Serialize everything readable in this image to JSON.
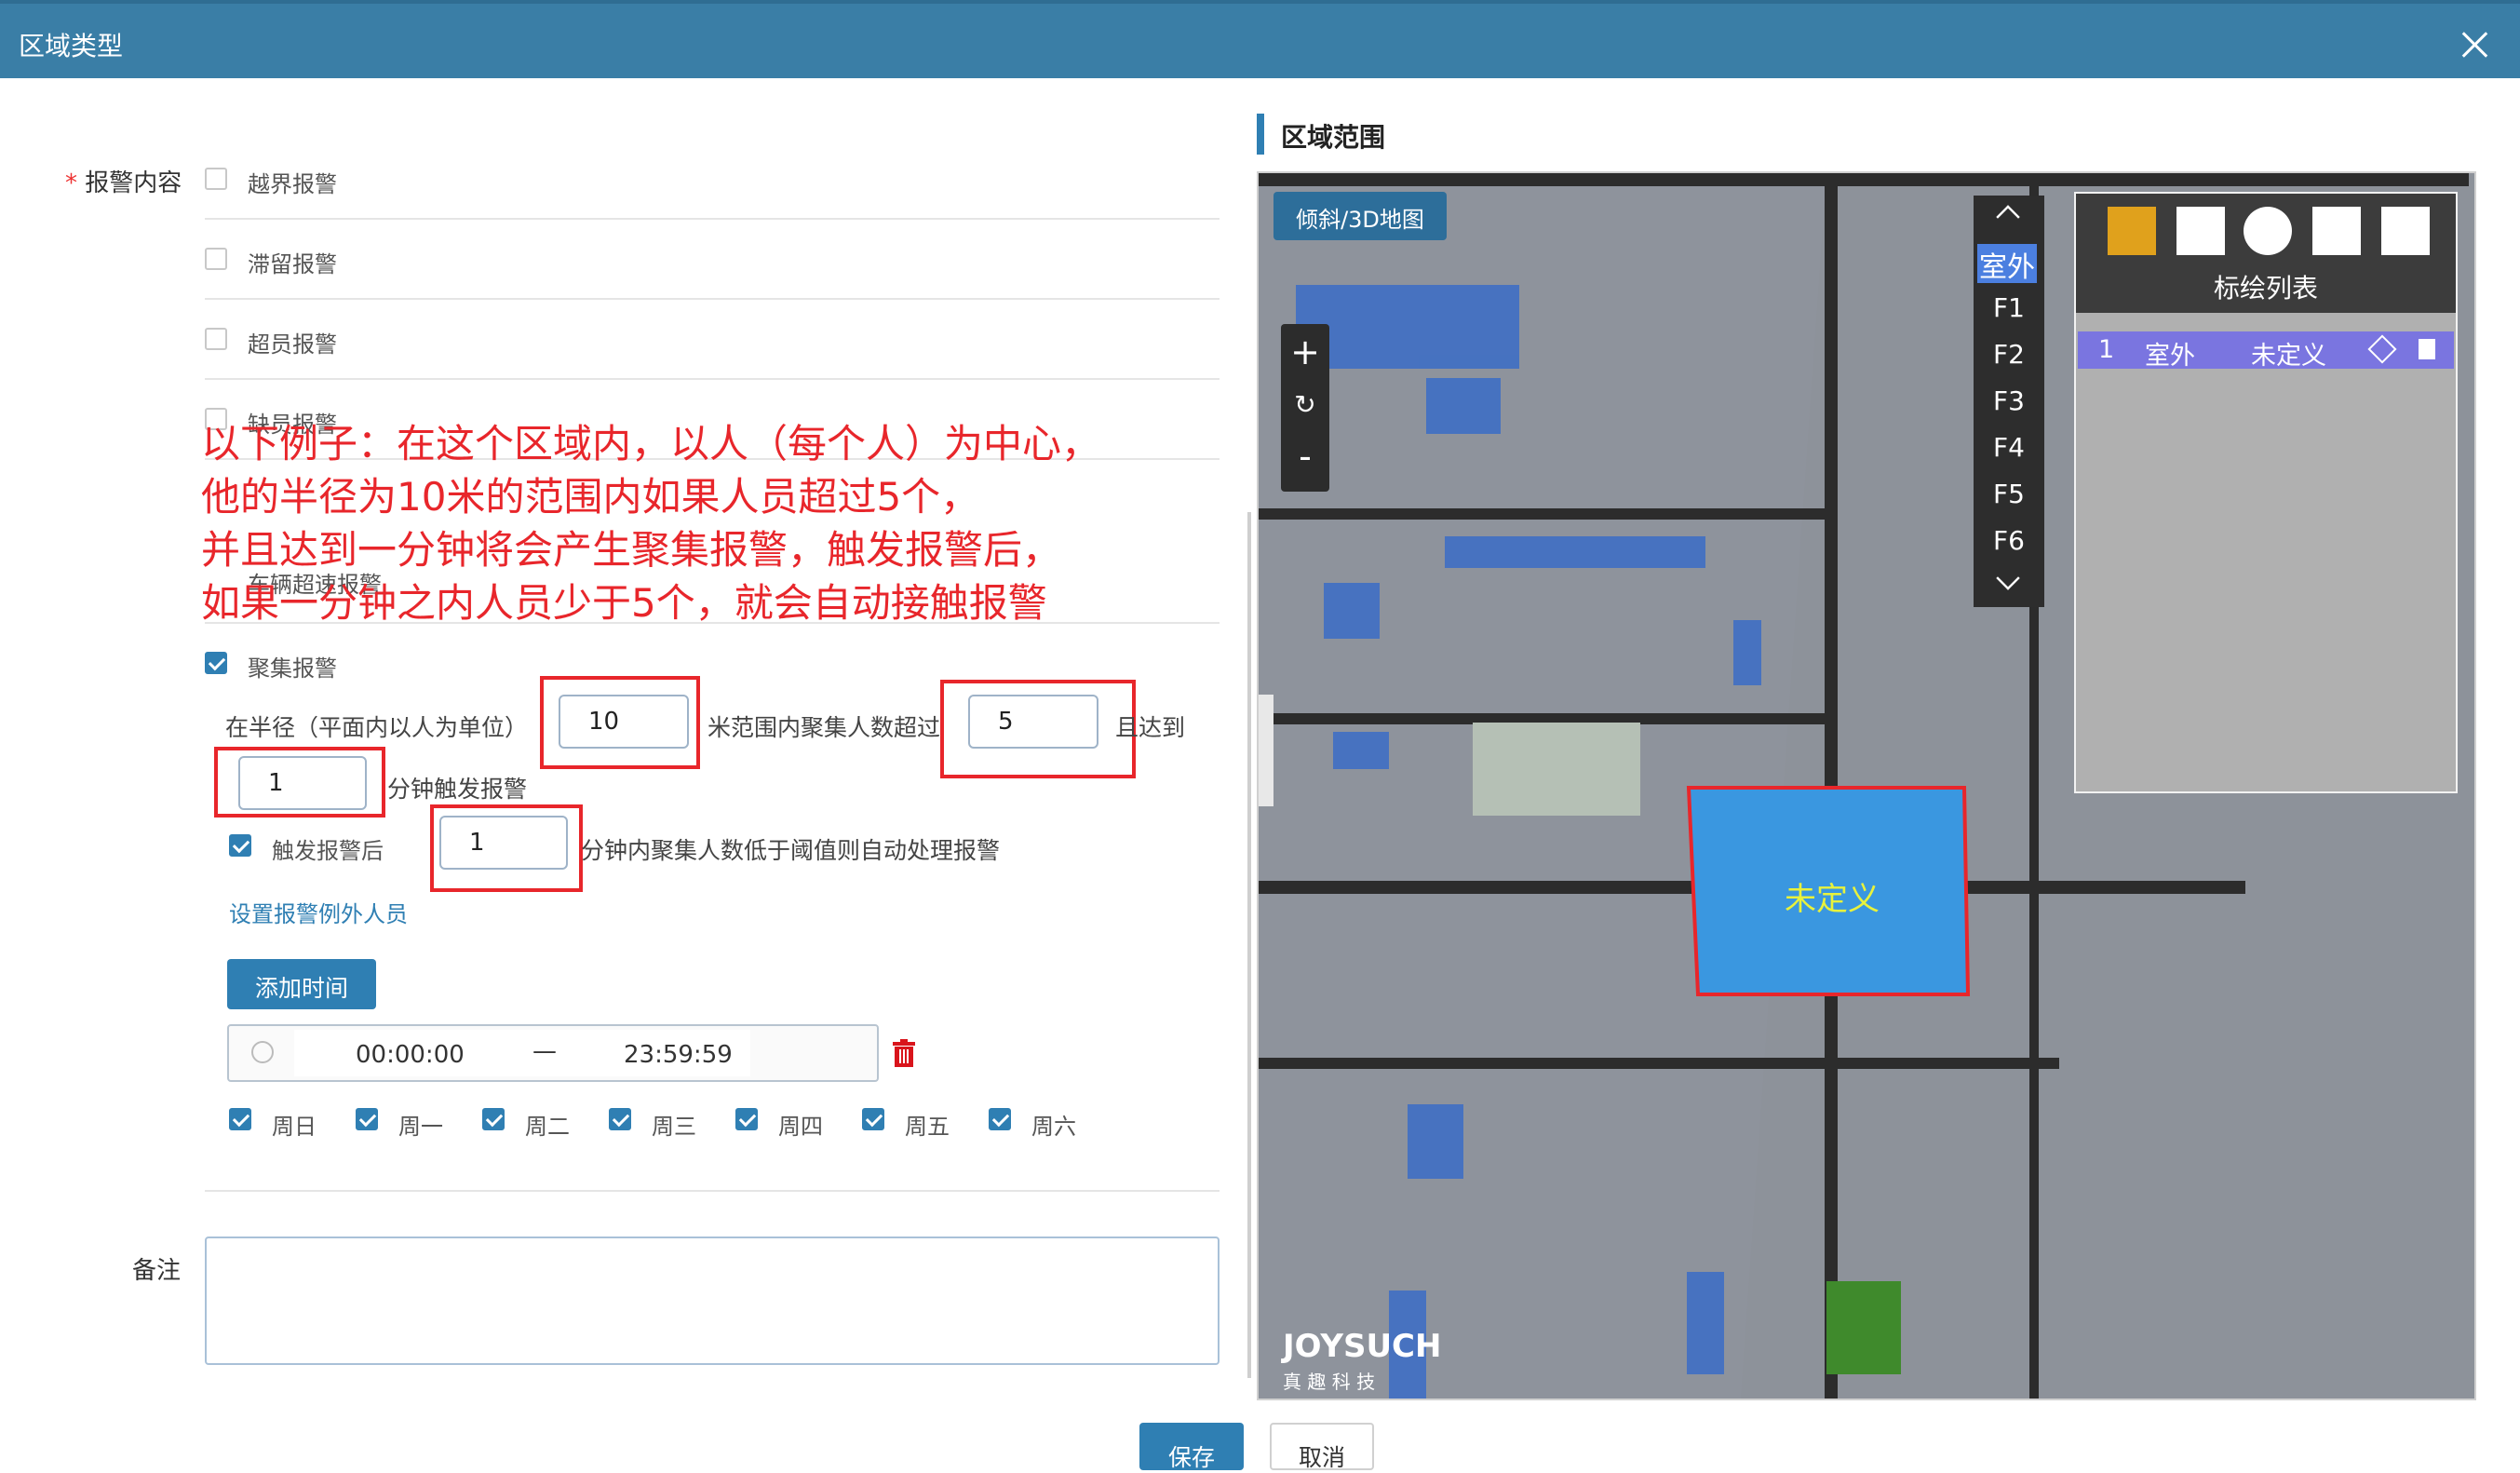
{
  "dialog": {
    "title": "区域类型",
    "close": "×"
  },
  "form": {
    "alarm_content_label": "报警内容",
    "required_mark": "*",
    "alarms": [
      {
        "label": "越界报警",
        "checked": false
      },
      {
        "label": "滞留报警",
        "checked": false
      },
      {
        "label": "超员报警",
        "checked": false
      },
      {
        "label": "缺员报警",
        "checked": false
      },
      {
        "label": "车辆超速报警",
        "checked": false
      },
      {
        "label": "聚集报警",
        "checked": true
      }
    ],
    "gather": {
      "radius_prefix": "在半径（平面内以人为单位）",
      "radius_value": "10",
      "count_prefix": "米范围内聚集人数超过",
      "count_value": "5",
      "reach_suffix": "且达到",
      "minutes_value": "1",
      "minutes_suffix": "分钟触发报警",
      "after_label": "触发报警后",
      "after_value": "1",
      "after_suffix": "分钟内聚集人数低于阈值则自动处理报警",
      "exception_link": "设置报警例外人员",
      "add_time_button": "添加时间",
      "time_start": "00:00:00",
      "time_sep": "—",
      "time_end": "23:59:59",
      "days": [
        {
          "label": "周日",
          "checked": true
        },
        {
          "label": "周一",
          "checked": true
        },
        {
          "label": "周二",
          "checked": true
        },
        {
          "label": "周三",
          "checked": true
        },
        {
          "label": "周四",
          "checked": true
        },
        {
          "label": "周五",
          "checked": true
        },
        {
          "label": "周六",
          "checked": true
        }
      ]
    },
    "remark_label": "备注",
    "remark_value": ""
  },
  "annotation": {
    "lines": [
      "以下例子：在这个区域内，以人（每个人）为中心，",
      "他的半径为10米的范围内如果人员超过5个，",
      "并且达到一分钟将会产生聚集报警，触发报警后，",
      "如果一分钟之内人员少于5个，就会自动接触报警"
    ]
  },
  "map_panel": {
    "title": "区域范围",
    "view_button": "倾斜/3D地图",
    "zoom_in": "+",
    "reset": "↻",
    "zoom_out": "-",
    "floors": [
      "室外",
      "F1",
      "F2",
      "F3",
      "F4",
      "F5",
      "F6"
    ],
    "active_floor": "室外",
    "draw_list_title": "标绘列表",
    "draw_items": [
      {
        "index": "1",
        "floor": "室外",
        "name": "未定义"
      }
    ],
    "region_label": "未定义",
    "logo": "JOYSUCH",
    "logo_sub": "真 趣 科 技"
  },
  "footer": {
    "save": "保存",
    "cancel": "取消"
  },
  "colors": {
    "header": "#3a7ea6",
    "primary": "#2f7fb3",
    "annotation": "#e8262b",
    "region": "#3a97e0"
  }
}
